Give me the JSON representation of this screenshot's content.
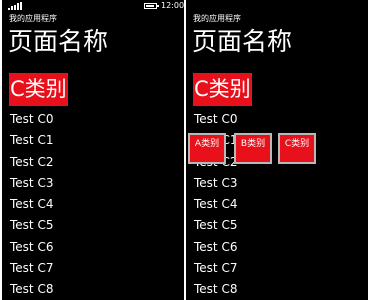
{
  "status_bar": {
    "time": "12:00",
    "battery_level": 0.85
  },
  "screens": [
    {
      "app_title": "我的应用程序",
      "page_title": "页面名称",
      "category_header": "C类别",
      "items": [
        "Test C0",
        "Test C1",
        "Test C2",
        "Test C3",
        "Test C4",
        "Test C5",
        "Test C6",
        "Test C7",
        "Test C8"
      ]
    },
    {
      "app_title": "我的应用程序",
      "page_title": "页面名称",
      "category_header": "C类别",
      "items": [
        "Test C0",
        "Test C1",
        "Test C2",
        "Test C3",
        "Test C4",
        "Test C5",
        "Test C6",
        "Test C7",
        "Test C8"
      ],
      "picker_buttons": [
        "A类别",
        "B类别",
        "C类别"
      ]
    }
  ],
  "colors": {
    "background": "#000000",
    "accent": "#e8101a",
    "text": "#ffffff",
    "picker_border": "#b8b8b8"
  }
}
